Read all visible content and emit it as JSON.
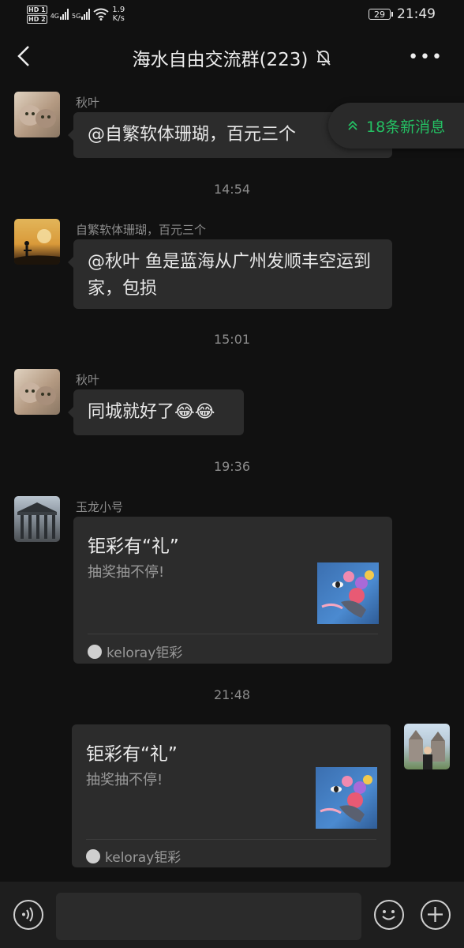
{
  "status_bar": {
    "hd1": "HD 1",
    "hd2": "HD 2",
    "net1": "4G",
    "net2": "5G",
    "speed_value": "1.9",
    "speed_unit": "K/s",
    "battery": "29",
    "time": "21:49"
  },
  "header": {
    "title": "海水自由交流群(223)",
    "more_label": "•••"
  },
  "new_messages": {
    "label": "18条新消息",
    "color": "#24c063"
  },
  "messages": [
    {
      "sender": "秋叶",
      "text": "@自繁软体珊瑚，百元三个"
    },
    {
      "time": "14:54"
    },
    {
      "sender": "自繁软体珊瑚，百元三个",
      "text": "@秋叶  鱼是蓝海从广州发顺丰空运到家，包损"
    },
    {
      "time": "15:01"
    },
    {
      "sender": "秋叶",
      "text": "同城就好了😂😂"
    },
    {
      "time": "19:36"
    },
    {
      "sender": "玉龙小号",
      "card": {
        "title": "钜彩有“礼”",
        "desc": "抽奖抽不停!",
        "source": "keloray钜彩"
      }
    },
    {
      "time": "21:48"
    },
    {
      "sender": "",
      "card": {
        "title": "钜彩有“礼”",
        "desc": "抽奖抽不停!",
        "source": "keloray钜彩"
      }
    }
  ],
  "input": {
    "value": ""
  },
  "icons": [
    "back-icon",
    "mute-bell-icon",
    "more-icon",
    "voice-icon",
    "emoji-icon",
    "plus-icon",
    "double-chevron-up-icon"
  ]
}
